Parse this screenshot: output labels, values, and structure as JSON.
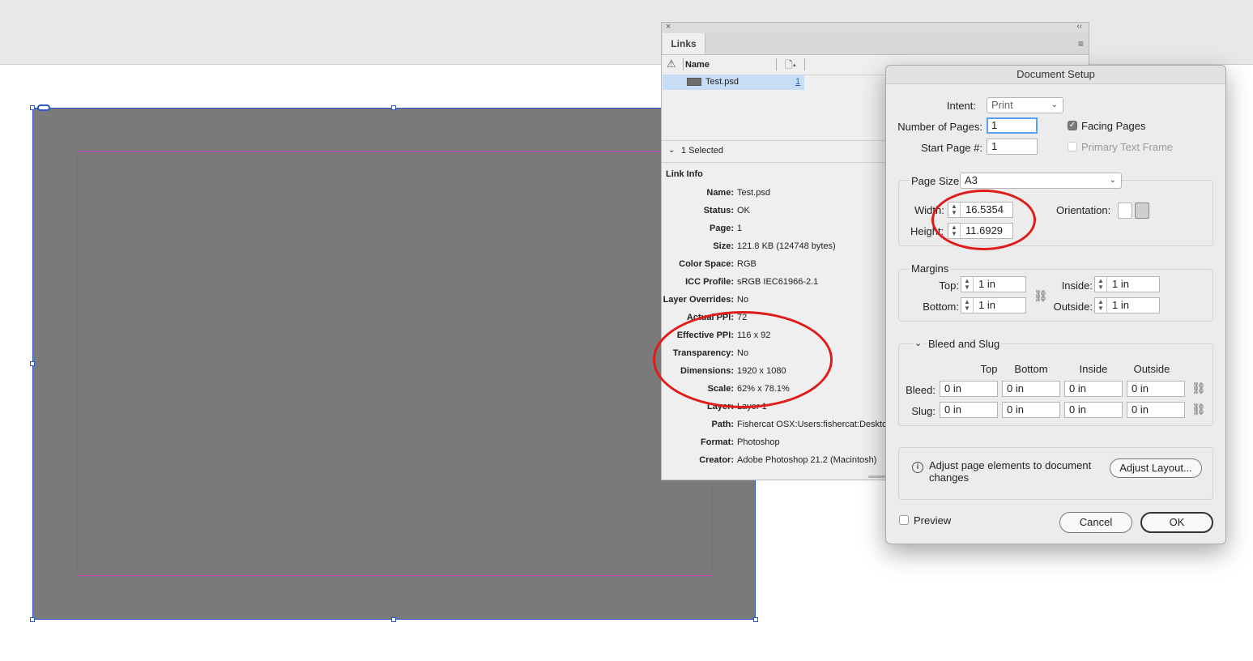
{
  "links_panel": {
    "tab_label": "Links",
    "column_name": "Name",
    "file": {
      "name": "Test.psd",
      "page": "1"
    },
    "selected_text": "1 Selected",
    "link_info_title": "Link Info",
    "info": [
      {
        "label": "Name:",
        "value": "Test.psd"
      },
      {
        "label": "Status:",
        "value": "OK"
      },
      {
        "label": "Page:",
        "value": "1"
      },
      {
        "label": "Size:",
        "value": "121.8 KB (124748 bytes)"
      },
      {
        "label": "Color Space:",
        "value": "RGB"
      },
      {
        "label": "ICC Profile:",
        "value": "sRGB IEC61966-2.1"
      },
      {
        "label": "Layer Overrides:",
        "value": "No"
      },
      {
        "label": "Actual PPI:",
        "value": "72"
      },
      {
        "label": "Effective PPI:",
        "value": "116 x 92"
      },
      {
        "label": "Transparency:",
        "value": "No"
      },
      {
        "label": "Dimensions:",
        "value": "1920 x 1080"
      },
      {
        "label": "Scale:",
        "value": "62% x 78.1%"
      },
      {
        "label": "Layer:",
        "value": "Layer 1"
      },
      {
        "label": "Path:",
        "value": "Fishercat OSX:Users:fishercat:Desktop"
      },
      {
        "label": "Format:",
        "value": "Photoshop"
      },
      {
        "label": "Creator:",
        "value": "Adobe Photoshop 21.2 (Macintosh)"
      }
    ]
  },
  "dialog": {
    "title": "Document Setup",
    "intent_label": "Intent:",
    "intent_value": "Print",
    "pages_label": "Number of Pages:",
    "pages_value": "1",
    "start_label": "Start Page #:",
    "start_value": "1",
    "facing_pages_label": "Facing Pages",
    "facing_pages_checked": true,
    "primary_text_frame_label": "Primary Text Frame",
    "primary_text_frame_checked": false,
    "page_size_label": "Page Size:",
    "page_size_value": "A3",
    "width_label": "Width:",
    "width_value": "16.5354",
    "height_label": "Height:",
    "height_value": "11.6929",
    "orientation_label": "Orientation:",
    "orientation_selected": "landscape",
    "margins": {
      "title": "Margins",
      "top_label": "Top:",
      "top_value": "1 in",
      "bottom_label": "Bottom:",
      "bottom_value": "1 in",
      "inside_label": "Inside:",
      "inside_value": "1 in",
      "outside_label": "Outside:",
      "outside_value": "1 in"
    },
    "bleed_slug": {
      "title": "Bleed and Slug",
      "columns": [
        "Top",
        "Bottom",
        "Inside",
        "Outside"
      ],
      "bleed_label": "Bleed:",
      "bleed_values": [
        "0 in",
        "0 in",
        "0 in",
        "0 in"
      ],
      "slug_label": "Slug:",
      "slug_values": [
        "0 in",
        "0 in",
        "0 in",
        "0 in"
      ]
    },
    "adjust_text": "Adjust page elements to document changes",
    "adjust_button": "Adjust Layout...",
    "preview_label": "Preview",
    "preview_checked": false,
    "cancel_label": "Cancel",
    "ok_label": "OK"
  },
  "colors": {
    "frame_fill": "#7a7a7a",
    "frame_border": "#2a56c6",
    "margin_guide": "#c23fc2",
    "annotation": "#e01b1b",
    "selection_row": "#c7dcf5"
  }
}
